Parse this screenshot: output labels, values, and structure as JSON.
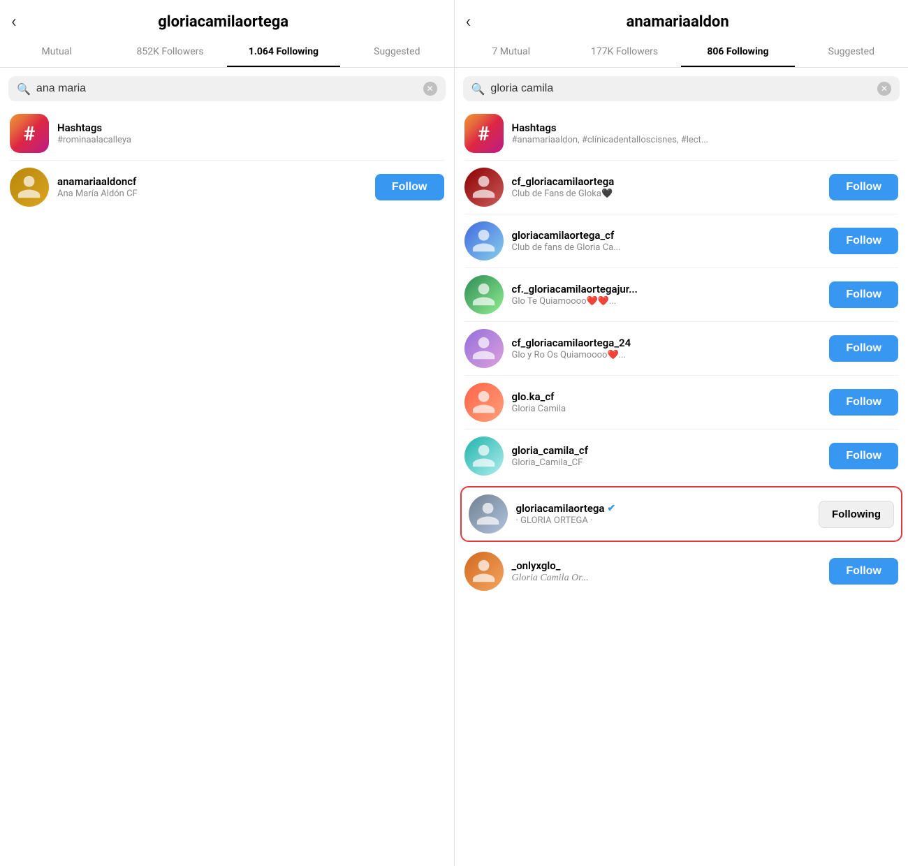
{
  "panels": [
    {
      "id": "left",
      "title": "gloriacamilaortega",
      "back_label": "‹",
      "tabs": [
        {
          "label": "Mutual",
          "active": false
        },
        {
          "label": "852K Followers",
          "active": false
        },
        {
          "label": "1.064 Following",
          "active": true
        },
        {
          "label": "Suggested",
          "active": false
        }
      ],
      "search": {
        "value": "ana maria",
        "placeholder": "Search"
      },
      "items": [
        {
          "type": "hashtag",
          "name": "Hashtags",
          "sub": "#rominaalacalleya",
          "has_follow": false
        },
        {
          "type": "user",
          "avatar_class": "av1",
          "name": "anamariaaldoncf",
          "sub": "Ana María Aldón CF",
          "button": "Follow",
          "button_type": "follow",
          "highlighted": false
        }
      ]
    },
    {
      "id": "right",
      "title": "anamariaaldon",
      "back_label": "‹",
      "tabs": [
        {
          "label": "7 Mutual",
          "active": false
        },
        {
          "label": "177K Followers",
          "active": false
        },
        {
          "label": "806 Following",
          "active": true
        },
        {
          "label": "Suggested",
          "active": false
        }
      ],
      "search": {
        "value": "gloria camila",
        "placeholder": "Search"
      },
      "items": [
        {
          "type": "hashtag",
          "name": "Hashtags",
          "sub": "#anamariaaldon, #clínicadentalloscisnes, #lect...",
          "has_follow": false
        },
        {
          "type": "user",
          "avatar_class": "av2",
          "name": "cf_gloriacamilaortega",
          "sub": "Club de Fans de Gloka🖤",
          "button": "Follow",
          "button_type": "follow",
          "highlighted": false
        },
        {
          "type": "user",
          "avatar_class": "av3",
          "name": "gloriacamilaortega_cf",
          "sub": "Club de fans de Gloria Ca...",
          "button": "Follow",
          "button_type": "follow",
          "highlighted": false
        },
        {
          "type": "user",
          "avatar_class": "av4",
          "name": "cf._gloriacamilaortegajur...",
          "sub": "Glo Te Quiamoooo❤️❤️...",
          "button": "Follow",
          "button_type": "follow",
          "highlighted": false
        },
        {
          "type": "user",
          "avatar_class": "av5",
          "name": "cf_gloriacamilaortega_24",
          "sub": "Glo y Ro Os Quiamoooo❤️...",
          "button": "Follow",
          "button_type": "follow",
          "highlighted": false
        },
        {
          "type": "user",
          "avatar_class": "av6",
          "name": "glo.ka_cf",
          "sub": "Gloria Camila",
          "button": "Follow",
          "button_type": "follow",
          "highlighted": false
        },
        {
          "type": "user",
          "avatar_class": "av7",
          "name": "gloria_camila_cf",
          "sub": "Gloria_Camila_CF",
          "button": "Follow",
          "button_type": "follow",
          "highlighted": false
        },
        {
          "type": "user",
          "avatar_class": "av8",
          "name": "gloriacamilaortega",
          "verified": true,
          "sub": "· GLORIA ORTEGA ·",
          "button": "Following",
          "button_type": "following",
          "highlighted": true
        },
        {
          "type": "user",
          "avatar_class": "av9",
          "name": "_onlyxglo_",
          "sub": "Gloria Camila Or...",
          "sub_script": true,
          "button": "Follow",
          "button_type": "follow",
          "highlighted": false
        }
      ]
    }
  ]
}
